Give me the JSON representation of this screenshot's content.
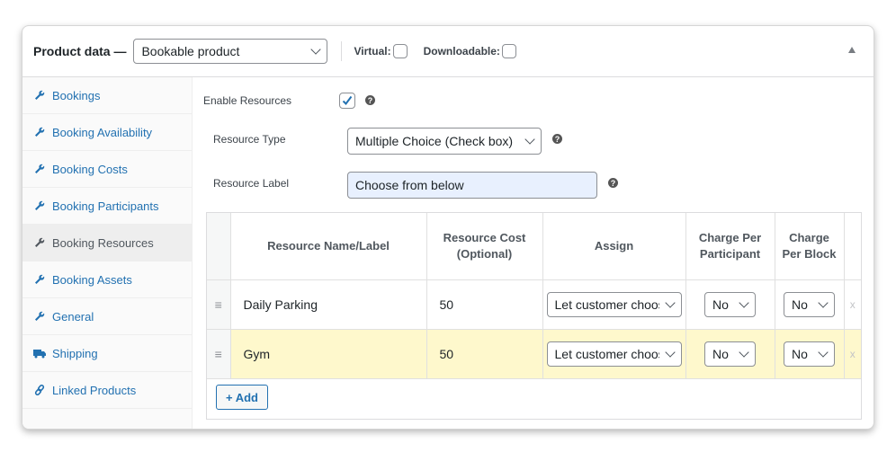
{
  "header": {
    "title": "Product data —",
    "product_type": "Bookable product",
    "virtual_label": "Virtual:",
    "virtual_checked": false,
    "downloadable_label": "Downloadable:",
    "downloadable_checked": false
  },
  "sidebar": {
    "items": [
      {
        "label": "Bookings",
        "icon": "wrench-icon"
      },
      {
        "label": "Booking Availability",
        "icon": "wrench-icon"
      },
      {
        "label": "Booking Costs",
        "icon": "wrench-icon"
      },
      {
        "label": "Booking Participants",
        "icon": "wrench-icon"
      },
      {
        "label": "Booking Resources",
        "icon": "wrench-icon",
        "active": true
      },
      {
        "label": "Booking Assets",
        "icon": "wrench-icon"
      },
      {
        "label": "General",
        "icon": "wrench-icon"
      },
      {
        "label": "Shipping",
        "icon": "truck-icon"
      },
      {
        "label": "Linked Products",
        "icon": "link-icon"
      }
    ]
  },
  "resources": {
    "enable_label": "Enable Resources",
    "enable_checked": true,
    "type_label": "Resource Type",
    "type_value": "Multiple Choice (Check box)",
    "label_label": "Resource Label",
    "label_value": "Choose from below",
    "help_glyph": "?",
    "table": {
      "columns": [
        "Resource Name/Label",
        "Resource Cost (Optional)",
        "Assign",
        "Charge Per Participant",
        "Charge Per Block"
      ],
      "rows": [
        {
          "name": "Daily Parking",
          "cost": "50",
          "assign": "Let customer choose",
          "per_participant": "No",
          "per_block": "No",
          "highlighted": false
        },
        {
          "name": "Gym",
          "cost": "50",
          "assign": "Let customer choose",
          "per_participant": "No",
          "per_block": "No",
          "highlighted": true
        }
      ],
      "remove_glyph": "x",
      "handle_glyph": "≡"
    },
    "add_button": "+ Add"
  }
}
